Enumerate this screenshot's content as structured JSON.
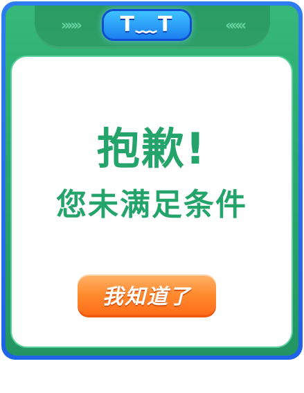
{
  "dialog": {
    "emoticon": "T﹏T",
    "chevrons_left": "»»»",
    "chevrons_right": "«««",
    "title": "抱歉!",
    "message": "您未满足条件",
    "button_label": "我知道了"
  },
  "colors": {
    "frame_blue": "#2f7cf0",
    "body_green": "#2aa56c",
    "text_green": "#24a46a",
    "button_orange": "#ff8a2e",
    "badge_blue": "#1b7ff0"
  }
}
